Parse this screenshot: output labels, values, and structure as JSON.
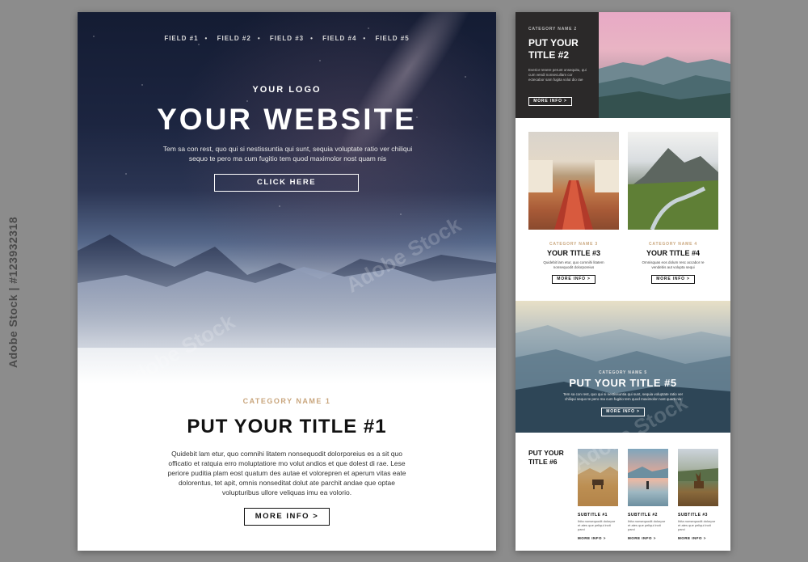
{
  "stock_label": "Adobe Stock | #123932318",
  "watermark_text": "Adobe Stock",
  "hero": {
    "fields": [
      "FIELD #1",
      "FIELD #2",
      "FIELD #3",
      "FIELD #4",
      "FIELD #5"
    ],
    "separator": "•",
    "logo": "YOUR LOGO",
    "title": "YOUR WEBSITE",
    "text": "Tem sa con rest, quo qui si nestissuntia qui sunt, sequia voluptate ratio ver chiliqui sequo te pero ma cum fugitio tem quod maximolor nost quam nis",
    "button": "CLICK HERE"
  },
  "section1": {
    "category": "CATEGORY NAME 1",
    "title": "PUT YOUR TITLE #1",
    "text": "Quidebit lam etur, quo comnihi litatem nonsequodit dolorporeius es a sit quo officatio et ratquia erro moluptatiore mo volut andios et que dolest di rae. Lese periore puditia plam eost quatum des autae et volorepren et aperum vitas eate dolorentus, tet apit, omnis nonseditat dolut ate parchit andae que optae volupturibus ullore veliquas imu ea volorio.",
    "button": "MORE INFO >"
  },
  "right": {
    "block2": {
      "category": "CATEGORY NAME 2",
      "title": "PUT YOUR TITLE #2",
      "text": "Everior renere perunt onsequitu, qui cum vendi nonsecullam cor ectecabor sam fugita volut dio rae",
      "button": "MORE INFO >"
    },
    "block3": {
      "category": "CATEGORY NAME 3",
      "title": "YOUR TITLE #3",
      "text": "Quidebit lam etur, quo comnihi litatem nonsequodit dolorporeius",
      "button": "MORE INFO >"
    },
    "block4": {
      "category": "CATEGORY NAME 4",
      "title": "YOUR TITLE #4",
      "text": "Omnisquas eos dolum resc accabor re vendebis aut volupta sequi",
      "button": "MORE INFO >"
    },
    "block5": {
      "category": "CATEGORY NAME 5",
      "title": "PUT YOUR TITLE #5",
      "text": "Tem sa con rest, quo qui si nestissuntia qui sunt, sequia voluptate ratio ver chiliqui sequo te pero ma cum fugitio tem quod maximolor nost quam nis",
      "button": "MORE INFO >"
    },
    "block6": {
      "title": "PUT YOUR TITLE #6",
      "subs": [
        {
          "title": "SUBTITLE #1",
          "text": "Ihita nonsequodit dolorpor et ates que peliqui incit parci",
          "more": "MORE INFO >"
        },
        {
          "title": "SUBTITLE #2",
          "text": "Ihita nonsequodit dolorpor et ates que peliqui incit parci",
          "more": "MORE INFO >"
        },
        {
          "title": "SUBTITLE #3",
          "text": "Ihita nonsequodit dolorpor et ates que peliqui incit parci",
          "more": "MORE INFO >"
        }
      ]
    }
  }
}
